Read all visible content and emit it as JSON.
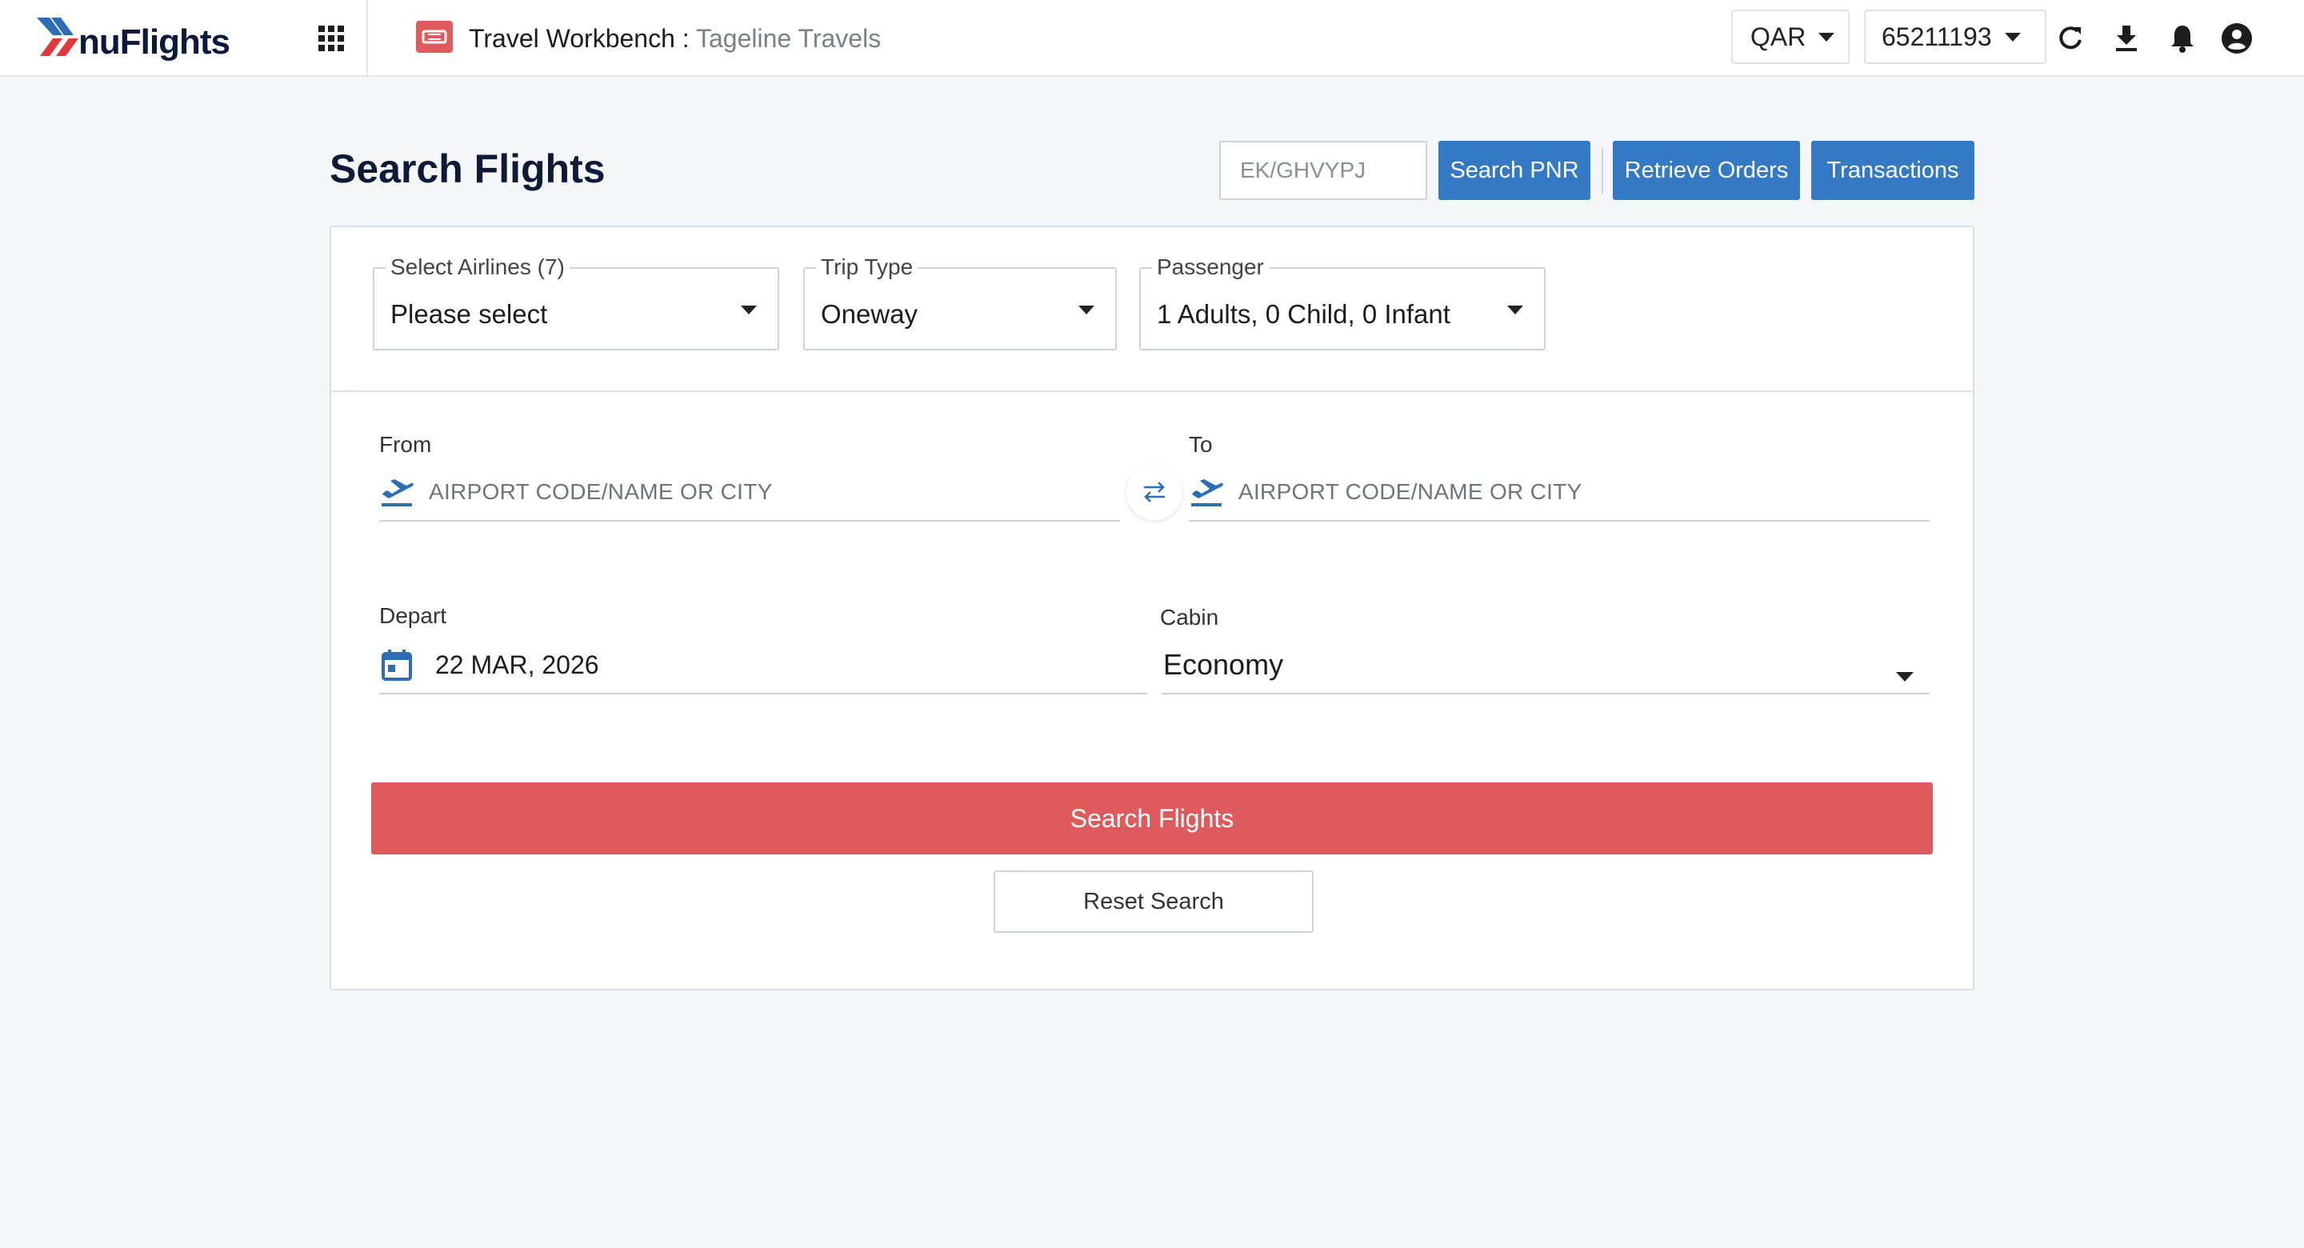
{
  "brand": {
    "name": "nuFlights"
  },
  "header": {
    "title": "Travel Workbench :",
    "subtitle": "Tageline Travels",
    "currency": "QAR",
    "account_id": "65211193"
  },
  "page": {
    "title": "Search Flights",
    "pnr_placeholder": "EK/GHVYPJ",
    "search_pnr_label": "Search PNR",
    "retrieve_orders_label": "Retrieve Orders",
    "transactions_label": "Transactions"
  },
  "filters": {
    "airlines": {
      "label": "Select Airlines (7)",
      "value": "Please select"
    },
    "trip_type": {
      "label": "Trip Type",
      "value": "Oneway"
    },
    "passenger": {
      "label": "Passenger",
      "value": "1 Adults, 0 Child, 0 Infant"
    }
  },
  "route": {
    "from_label": "From",
    "from_placeholder": "AIRPORT CODE/NAME OR CITY",
    "to_label": "To",
    "to_placeholder": "AIRPORT CODE/NAME OR CITY"
  },
  "depart": {
    "label": "Depart",
    "value": "22 MAR, 2026"
  },
  "cabin": {
    "label": "Cabin",
    "value": "Economy"
  },
  "actions": {
    "search_label": "Search Flights",
    "reset_label": "Reset Search"
  },
  "colors": {
    "accent_blue": "#3479c4",
    "search_red": "#df5a5d",
    "title_navy": "#0d1b36",
    "logo_red": "#e0383e"
  },
  "icons": {
    "apps": "apps-grid-icon",
    "workbench": "workbench-icon",
    "refresh": "refresh-icon",
    "download": "download-icon",
    "notifications": "bell-icon",
    "account": "account-circle-icon",
    "from": "flight-takeoff-icon",
    "to": "flight-takeoff-icon",
    "swap": "swap-arrows-icon",
    "depart": "calendar-icon"
  }
}
